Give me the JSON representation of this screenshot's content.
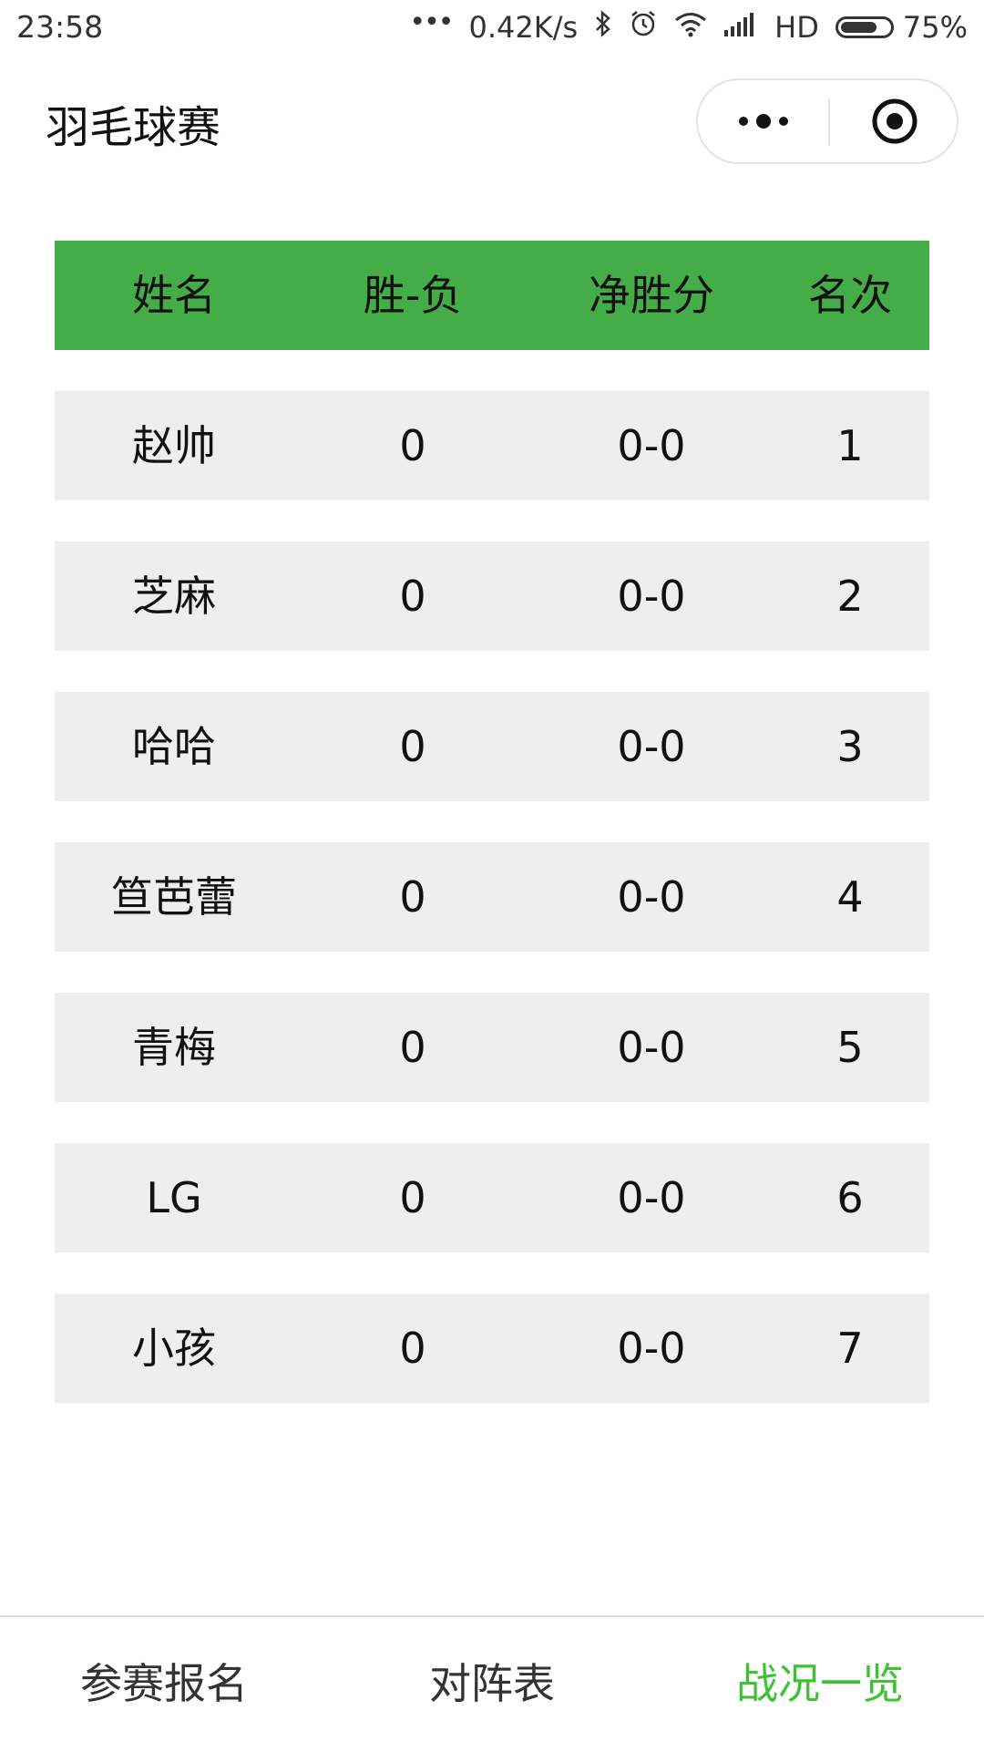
{
  "status_bar": {
    "time": "23:58",
    "network_speed": "0.42K/s",
    "network_type": "HD",
    "battery_percent": "75%",
    "battery_level": 0.75,
    "icons": [
      "more-dots-icon",
      "bluetooth-icon",
      "alarm-icon",
      "wifi-icon",
      "signal-icon",
      "battery-icon"
    ]
  },
  "header": {
    "title": "羽毛球赛",
    "more_icon": "more-dots-icon",
    "close_icon": "target-close-icon"
  },
  "table": {
    "columns": [
      "姓名",
      "胜-负",
      "净胜分",
      "名次"
    ],
    "rows": [
      {
        "name": "赵帅",
        "win_loss": "0",
        "net_points": "0-0",
        "rank": "1"
      },
      {
        "name": "芝麻",
        "win_loss": "0",
        "net_points": "0-0",
        "rank": "2"
      },
      {
        "name": "哈哈",
        "win_loss": "0",
        "net_points": "0-0",
        "rank": "3"
      },
      {
        "name": "笪芭蕾",
        "win_loss": "0",
        "net_points": "0-0",
        "rank": "4"
      },
      {
        "name": "青梅",
        "win_loss": "0",
        "net_points": "0-0",
        "rank": "5"
      },
      {
        "name": "LG",
        "win_loss": "0",
        "net_points": "0-0",
        "rank": "6"
      },
      {
        "name": "小孩",
        "win_loss": "0",
        "net_points": "0-0",
        "rank": "7"
      }
    ]
  },
  "tabs": [
    {
      "label": "参赛报名",
      "active": false
    },
    {
      "label": "对阵表",
      "active": false
    },
    {
      "label": "战况一览",
      "active": true
    }
  ],
  "colors": {
    "header_green": "#45ad48",
    "active_tab": "#3ec234",
    "row_bg": "#eeeeee"
  }
}
